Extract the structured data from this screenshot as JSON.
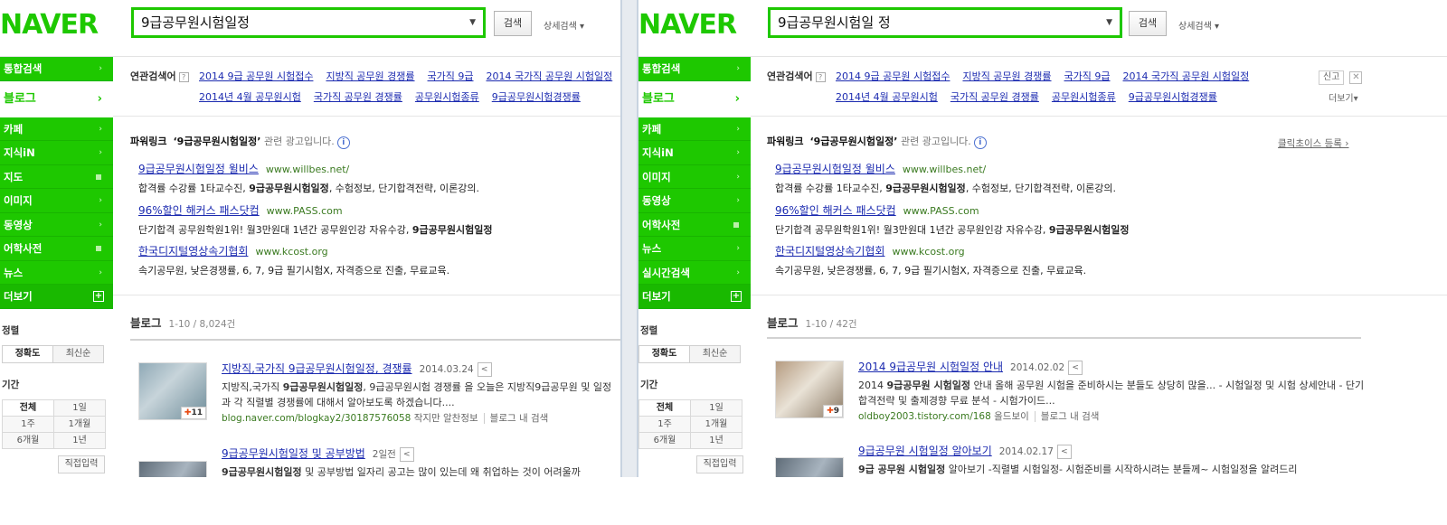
{
  "left": {
    "logo": "NAVER",
    "query": "9급공무원시험일정",
    "search_btn": "검색",
    "detail_search": "상세검색 ▾",
    "nav": [
      {
        "label": "통합검색",
        "mark": "›"
      },
      {
        "label": "블로그",
        "mark": "›"
      },
      {
        "label": "카페",
        "mark": "›"
      },
      {
        "label": "지식iN",
        "mark": "›"
      },
      {
        "label": "지도",
        "mark": ""
      },
      {
        "label": "이미지",
        "mark": "›"
      },
      {
        "label": "동영상",
        "mark": "›"
      },
      {
        "label": "어학사전",
        "mark": ""
      },
      {
        "label": "뉴스",
        "mark": "›"
      },
      {
        "label": "더보기",
        "mark": "+"
      }
    ],
    "sort_label": "정렬",
    "sort_opts": [
      "정확도",
      "최신순"
    ],
    "period_label": "기간",
    "period_opts": [
      "전체",
      "1일",
      "1주",
      "1개월",
      "6개월",
      "1년"
    ],
    "direct": "직접입력",
    "related_label": "연관검색어",
    "related_row1": [
      "2014 9급 공무원 시험접수",
      "지방직 공무원 경쟁률",
      "국가직 9급",
      "2014 국가직 공무원 시험일정"
    ],
    "related_row2": [
      "2014년 4월 공무원시험",
      "국가직 공무원 경쟁률",
      "공무원시험종류",
      "9급공무원시험경쟁률"
    ],
    "powerlink_title": "파워링크",
    "powerlink_query": "‘9급공무원시험일정’",
    "powerlink_sub": "관련 광고입니다.",
    "ads": [
      {
        "title": "9급공무원시험일정 윌비스",
        "url": "www.willbes.net/",
        "pre": "합격률 수강률 1타교수진, ",
        "bold": "9급공무원시험일정",
        "post": ", 수험정보, 단기합격전략, 이론강의."
      },
      {
        "title": "96%할인 해커스 패스닷컴",
        "url": "www.PASS.com",
        "pre": "단기합격 공무원학원1위! 월3만원대 1년간 공무원인강 자유수강, ",
        "bold": "9급공무원시험일정",
        "post": ""
      },
      {
        "title": "한국디지털영상속기협회",
        "url": "www.kcost.org",
        "pre": "속기공무원, 낮은경쟁률, 6, 7, 9급 필기시험X, 자격증으로 진출, 무료교육.",
        "bold": "",
        "post": ""
      }
    ],
    "blog_label": "블로그",
    "blog_count": "1-10 / 8,024건",
    "results": [
      {
        "title": "지방직,국가직 9급공무원시험일정, 경쟁률",
        "date": "2014.03.24",
        "desc_pre": "지방직,국가직 ",
        "desc_bold": "9급공무원시험일정",
        "desc_post": ", 9급공무원시험 경쟁률 을 오늘은 지방직9급공무원 및 일정과 각 직렬별 경쟁률에 대해서 알아보도록 하겠습니다....",
        "url": "blog.naver.com/blogkay2/30187576058",
        "writer": "작지만 알찬정보",
        "blog_search": "블로그 내 검색",
        "badge": "11"
      },
      {
        "title": "9급공무원시험일정 및 공부방법",
        "date": "2일전",
        "desc_pre": "",
        "desc_bold": "9급공무원시험일정",
        "desc_post": " 및 공부방법 일자리 공고는 많이 있는데 왜 취업하는 것이 어려울까"
      }
    ]
  },
  "right": {
    "logo": "NAVER",
    "query": "9급공무원시험일 정",
    "search_btn": "검색",
    "detail_search": "상세검색 ▾",
    "nav": [
      {
        "label": "통합검색",
        "mark": "›"
      },
      {
        "label": "블로그",
        "mark": "›"
      },
      {
        "label": "카페",
        "mark": "›"
      },
      {
        "label": "지식iN",
        "mark": "›"
      },
      {
        "label": "이미지",
        "mark": "›"
      },
      {
        "label": "동영상",
        "mark": "›"
      },
      {
        "label": "어학사전",
        "mark": ""
      },
      {
        "label": "뉴스",
        "mark": "›"
      },
      {
        "label": "실시간검색",
        "mark": "›"
      },
      {
        "label": "더보기",
        "mark": "+"
      }
    ],
    "sort_label": "정렬",
    "sort_opts": [
      "정확도",
      "최신순"
    ],
    "period_label": "기간",
    "period_opts": [
      "전체",
      "1일",
      "1주",
      "1개월",
      "6개월",
      "1년"
    ],
    "direct": "직접입력",
    "related_label": "연관검색어",
    "related_row1": [
      "2014 9급 공무원 시험접수",
      "지방직 공무원 경쟁률",
      "국가직 9급",
      "2014 국가직 공무원 시험일정"
    ],
    "related_row2": [
      "2014년 4월 공무원시험",
      "국가직 공무원 경쟁률",
      "공무원시험종류",
      "9급공무원시험경쟁률"
    ],
    "report": "신고",
    "more": "더보기▾",
    "powerlink_title": "파워링크",
    "powerlink_query": "‘9급공무원시험일정’",
    "powerlink_sub": "관련 광고입니다.",
    "click_choice": "클릭초이스 등록 ›",
    "ads": [
      {
        "title": "9급공무원시험일정 윌비스",
        "url": "www.willbes.net/",
        "pre": "합격률 수강률 1타교수진, ",
        "bold": "9급공무원시험일정",
        "post": ", 수험정보, 단기합격전략, 이론강의."
      },
      {
        "title": "96%할인 해커스 패스닷컴",
        "url": "www.PASS.com",
        "pre": "단기합격 공무원학원1위! 월3만원대 1년간 공무원인강 자유수강, ",
        "bold": "9급공무원시험일정",
        "post": ""
      },
      {
        "title": "한국디지털영상속기협회",
        "url": "www.kcost.org",
        "pre": "속기공무원, 낮은경쟁률, 6, 7, 9급 필기시험X, 자격증으로 진출, 무료교육.",
        "bold": "",
        "post": ""
      }
    ],
    "blog_label": "블로그",
    "blog_count": "1-10 / 42건",
    "results": [
      {
        "title": "2014 9급공무원 시험일정 안내",
        "date": "2014.02.02",
        "desc_pre": "2014 ",
        "desc_bold": "9급공무원 시험일정",
        "desc_post": " 안내 올해 공무원 시험을 준비하시는 분들도 상당히 많을... - 시험일정 및 시험 상세안내 - 단기 합격전략 및 출제경향 무료 분석 - 시험가이드...",
        "url": "oldboy2003.tistory.com/168",
        "writer": "올드보이",
        "blog_search": "블로그 내 검색",
        "badge": "9"
      },
      {
        "title": "9급공무원 시험일정 알아보기",
        "date": "2014.02.17",
        "desc_pre": "",
        "desc_bold": "9급 공무원 시험일정",
        "desc_post": " 알아보기 -직렬별 시험일정- 시험준비를 시작하시려는 분들께~ 시험일정을 알려드리"
      }
    ]
  }
}
